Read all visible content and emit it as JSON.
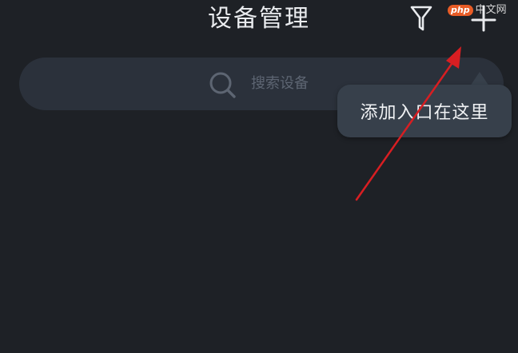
{
  "header": {
    "title": "设备管理"
  },
  "icons": {
    "filter": "filter-icon",
    "add": "plus-icon",
    "search": "search-icon"
  },
  "watermark": {
    "badge": "php",
    "text": "中文网"
  },
  "search": {
    "placeholder": "搜索设备"
  },
  "tooltip": {
    "text": "添加入口在这里"
  },
  "colors": {
    "background": "#1e2126",
    "search_bg": "#2b313b",
    "tooltip_bg": "#37404b",
    "annotation_arrow": "#d81e22",
    "watermark_badge": "#e85c26"
  }
}
